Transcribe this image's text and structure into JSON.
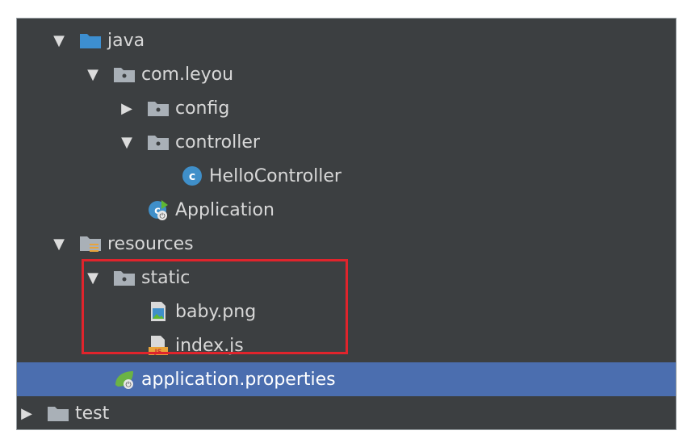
{
  "tree": {
    "items": [
      {
        "label": "java",
        "indent": 0,
        "arrow": "expanded",
        "icon": "java-source-folder-icon"
      },
      {
        "label": "com.leyou",
        "indent": 1,
        "arrow": "expanded",
        "icon": "package-folder-icon"
      },
      {
        "label": "config",
        "indent": 2,
        "arrow": "collapsed",
        "icon": "package-folder-icon"
      },
      {
        "label": "controller",
        "indent": 2,
        "arrow": "expanded",
        "icon": "package-folder-icon"
      },
      {
        "label": "HelloController",
        "indent": 3,
        "arrow": "none",
        "icon": "java-class-icon"
      },
      {
        "label": "Application",
        "indent": 2,
        "arrow": "none",
        "icon": "spring-boot-class-icon"
      },
      {
        "label": "resources",
        "indent": 0,
        "arrow": "expanded",
        "icon": "resources-folder-icon"
      },
      {
        "label": "static",
        "indent": 1,
        "arrow": "expanded",
        "icon": "folder-icon"
      },
      {
        "label": "baby.png",
        "indent": 2,
        "arrow": "none",
        "icon": "image-file-icon"
      },
      {
        "label": "index.js",
        "indent": 2,
        "arrow": "none",
        "icon": "js-file-icon"
      },
      {
        "label": "application.properties",
        "indent": 1,
        "arrow": "none",
        "icon": "spring-properties-icon",
        "selected": true
      },
      {
        "label": "test",
        "indent": -1,
        "arrow": "collapsed",
        "icon": "folder-icon"
      }
    ]
  },
  "colors": {
    "panel_bg": "#3c3f41",
    "selection": "#4b6eaf",
    "highlight_border": "#e0242c",
    "text": "#d8d8d8"
  }
}
